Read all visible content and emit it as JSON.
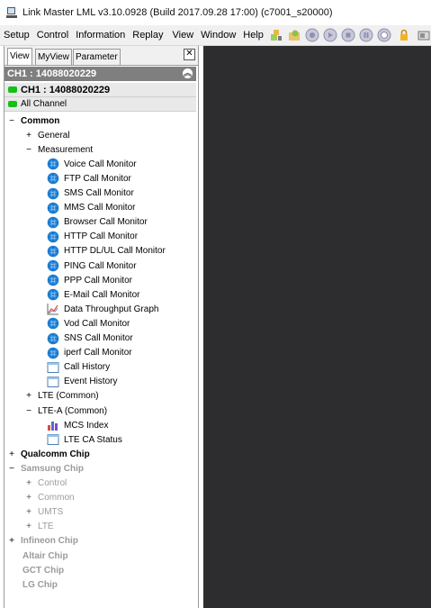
{
  "window": {
    "title": "Link Master LML v3.10.0928 (Build 2017.09.28 17:00) (c7001_s20000)"
  },
  "menu": [
    "Setup",
    "Control",
    "Information",
    "Replay",
    "View",
    "Window",
    "Help"
  ],
  "toolbar_icons": [
    "settings-icon",
    "open-folder-icon",
    "record-icon",
    "play-icon",
    "stop-icon",
    "pause-icon",
    "capture-icon",
    "lock-icon",
    "export-icon"
  ],
  "panel": {
    "tabs": [
      "View",
      "MyView",
      "Parameter"
    ],
    "close_label": "✕",
    "channel_header": "CH1 : 14088020229",
    "channel_row": "CH1 : 14088020229",
    "all_channel": "All Channel"
  },
  "tree": [
    {
      "label": "Common",
      "expander": "−",
      "style": "bold"
    },
    {
      "label": "General",
      "expander": "+"
    },
    {
      "label": "Measurement",
      "expander": "−"
    },
    {
      "label": "Voice Call Monitor",
      "icon": "monitor-globe-icon"
    },
    {
      "label": "FTP Call Monitor",
      "icon": "monitor-globe-icon"
    },
    {
      "label": "SMS Call Monitor",
      "icon": "monitor-globe-icon"
    },
    {
      "label": "MMS Call Monitor",
      "icon": "monitor-globe-icon"
    },
    {
      "label": "Browser Call Monitor",
      "icon": "monitor-globe-icon"
    },
    {
      "label": "HTTP Call Monitor",
      "icon": "monitor-globe-icon"
    },
    {
      "label": "HTTP DL/UL Call Monitor",
      "icon": "monitor-globe-icon"
    },
    {
      "label": "PING Call Monitor",
      "icon": "monitor-globe-icon"
    },
    {
      "label": "PPP Call Monitor",
      "icon": "monitor-globe-icon"
    },
    {
      "label": "E-Mail Call Monitor",
      "icon": "monitor-globe-icon"
    },
    {
      "label": "Data Throughput Graph",
      "icon": "line-graph-icon"
    },
    {
      "label": "Vod Call Monitor",
      "icon": "monitor-globe-icon"
    },
    {
      "label": "SNS Call Monitor",
      "icon": "monitor-globe-icon"
    },
    {
      "label": "iperf Call Monitor",
      "icon": "monitor-globe-icon"
    },
    {
      "label": "Call History",
      "icon": "window-icon"
    },
    {
      "label": "Event History",
      "icon": "window-icon"
    },
    {
      "label": "LTE (Common)",
      "expander": "+"
    },
    {
      "label": "LTE-A (Common)",
      "expander": "−"
    },
    {
      "label": "MCS Index",
      "icon": "bar-chart-icon"
    },
    {
      "label": "LTE CA Status",
      "icon": "window-icon"
    },
    {
      "label": "Qualcomm Chip",
      "expander": "+",
      "style": "bold"
    },
    {
      "label": "Samsung Chip",
      "expander": "−",
      "style": "gray"
    },
    {
      "label": "Control",
      "expander": "+",
      "style": "gray2"
    },
    {
      "label": "Common",
      "expander": "+",
      "style": "gray2"
    },
    {
      "label": "UMTS",
      "expander": "+",
      "style": "gray2"
    },
    {
      "label": "LTE",
      "expander": "+",
      "style": "gray2"
    },
    {
      "label": "Infineon Chip",
      "expander": "+",
      "style": "gray"
    },
    {
      "label": "Altair Chip",
      "style": "gray"
    },
    {
      "label": "GCT Chip",
      "style": "gray"
    },
    {
      "label": "LG Chip",
      "style": "gray"
    }
  ]
}
